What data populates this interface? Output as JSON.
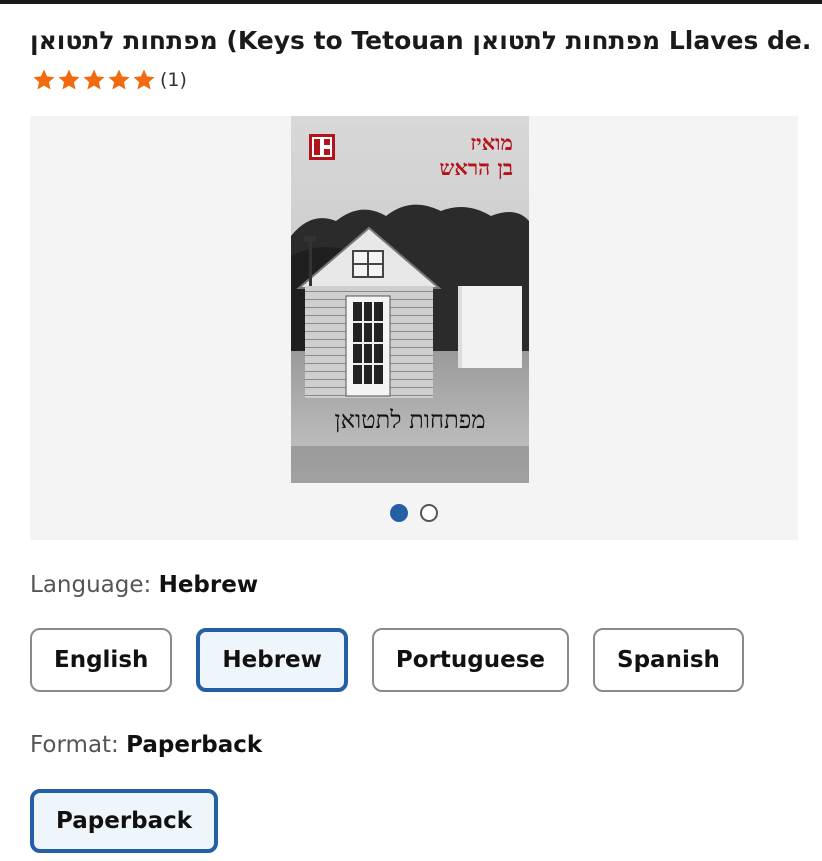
{
  "product": {
    "title": "מפתחות לתטואן (Keys to Tetouan מפתחות לתטואן Llaves de...",
    "rating": 5,
    "rating_count": "(1)"
  },
  "cover": {
    "author": [
      "מואיז",
      "בן הראש"
    ],
    "title": "מפתחות לתטואן"
  },
  "gallery": {
    "pages": 2,
    "current": 1
  },
  "language": {
    "label": "Language:",
    "selected": "Hebrew",
    "options": [
      "English",
      "Hebrew",
      "Portuguese",
      "Spanish"
    ]
  },
  "format": {
    "label": "Format:",
    "selected": "Paperback",
    "options": [
      "Paperback"
    ]
  },
  "colors": {
    "accent": "#2360a5",
    "selected_bg": "#eef6fb",
    "star": "#f26a10",
    "cover_red": "#b3141b"
  }
}
